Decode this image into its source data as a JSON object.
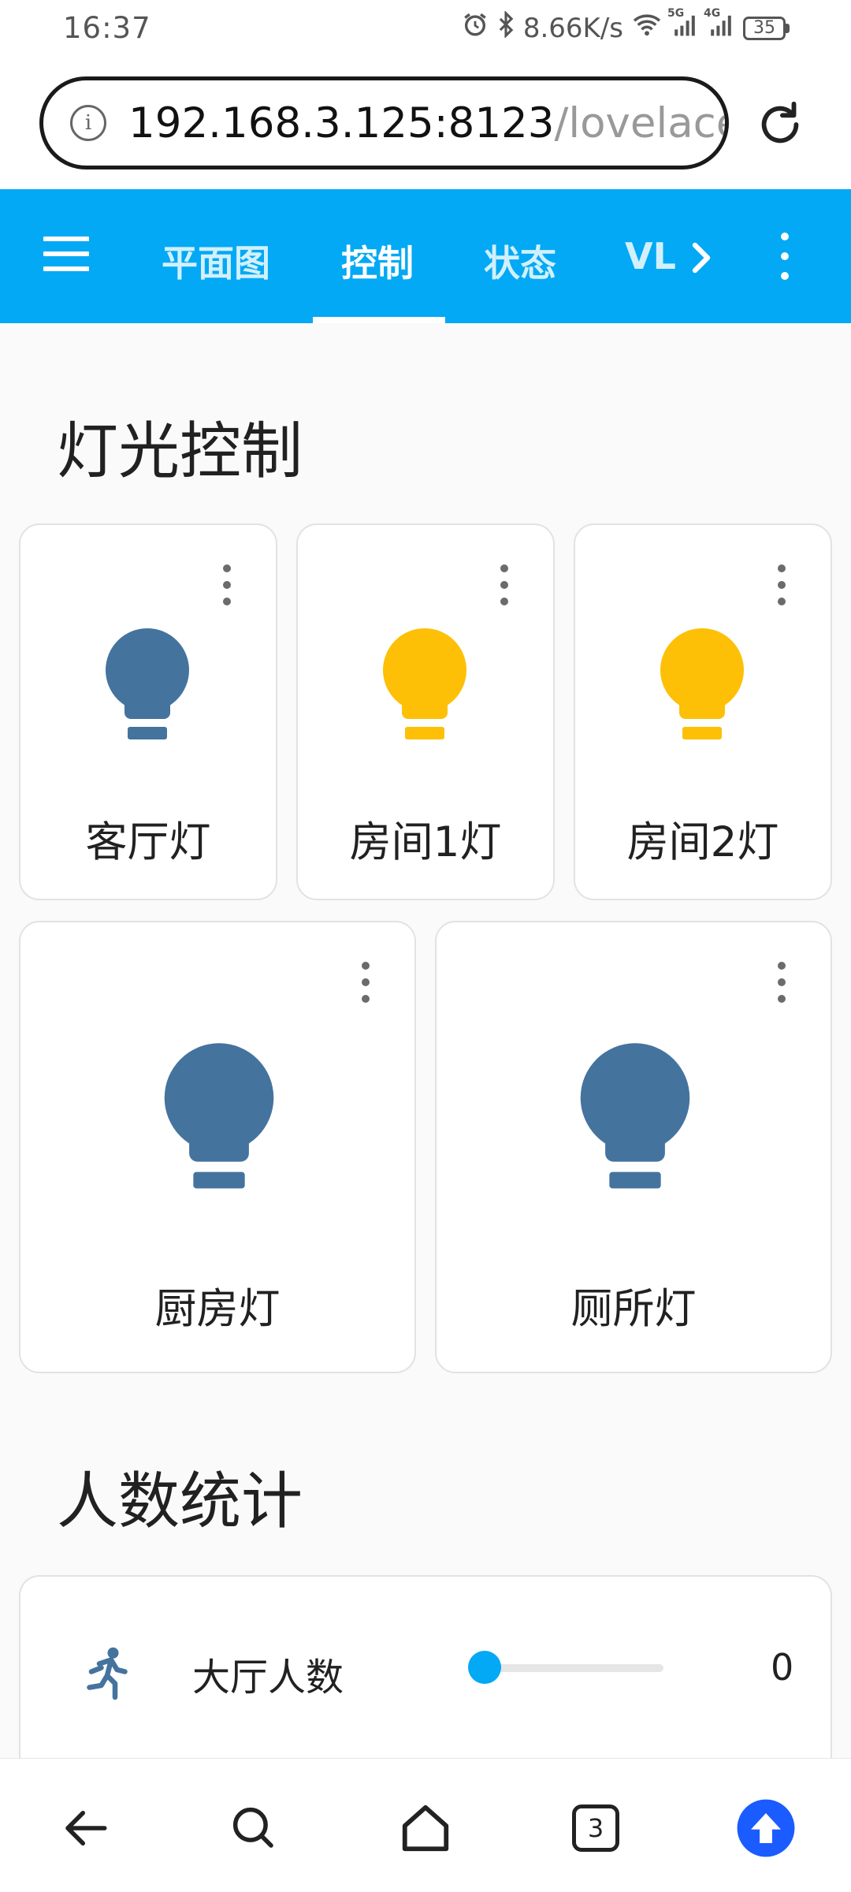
{
  "status_bar": {
    "time": "16:37",
    "network_speed": "8.66K/s",
    "signal_5g": "5G",
    "signal_4g": "4G",
    "battery": "35",
    "icons": [
      "alarm-icon",
      "bluetooth-icon",
      "wifi-icon",
      "signal-5g-icon",
      "signal-4g-icon",
      "battery-icon"
    ]
  },
  "browser": {
    "url_host": "192.168.3.125:8123",
    "url_path": "/lovelace",
    "info_glyph": "i",
    "tabs_count": "3"
  },
  "header": {
    "tabs": [
      {
        "label": "平面图",
        "active": false
      },
      {
        "label": "控制",
        "active": true
      },
      {
        "label": "状态",
        "active": false
      },
      {
        "label": "VL",
        "active": false
      }
    ],
    "color": "#03a9f4"
  },
  "lights": {
    "title": "灯光控制",
    "items": [
      {
        "name": "客厅灯",
        "state": "off"
      },
      {
        "name": "房间1灯",
        "state": "on"
      },
      {
        "name": "房间2灯",
        "state": "on"
      },
      {
        "name": "厨房灯",
        "state": "off"
      },
      {
        "name": "厕所灯",
        "state": "off"
      }
    ],
    "on_color": "#fdc006",
    "off_color": "#44739e"
  },
  "people": {
    "title": "人数统计",
    "rows": [
      {
        "label": "大厅人数",
        "value": "0",
        "slider_fraction": 0
      }
    ]
  }
}
